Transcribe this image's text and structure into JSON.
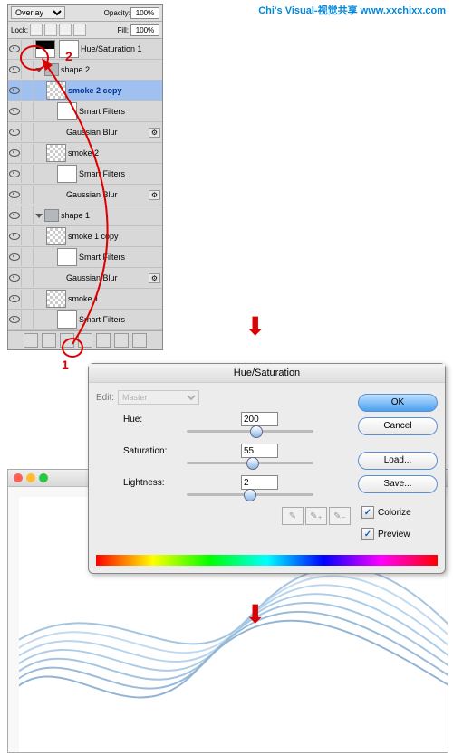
{
  "header": {
    "text": "Chi's Visual-视觉共享  www.xxchixx.com"
  },
  "layers_panel": {
    "blend_mode": "Overlay",
    "opacity_label": "Opacity:",
    "opacity": "100%",
    "lock_label": "Lock:",
    "fill_label": "Fill:",
    "fill": "100%",
    "hue_sat_layer": "Hue/Saturation 1",
    "group2": "shape 2",
    "smoke2copy": "smoke 2 copy",
    "smart_filters": "Smart Filters",
    "gaussian_blur": "Gaussian Blur",
    "smoke2": "smoke 2",
    "group1": "shape 1",
    "smoke1copy": "smoke 1 copy",
    "smoke1": "smoke 1"
  },
  "annotations": {
    "num1": "1",
    "num2": "2"
  },
  "dialog": {
    "title": "Hue/Saturation",
    "edit_label": "Edit:",
    "edit_value": "Master",
    "hue_label": "Hue:",
    "hue_value": "200",
    "sat_label": "Saturation:",
    "sat_value": "55",
    "light_label": "Lightness:",
    "light_value": "2",
    "ok": "OK",
    "cancel": "Cancel",
    "load": "Load...",
    "save": "Save...",
    "colorize": "Colorize",
    "preview": "Preview"
  }
}
